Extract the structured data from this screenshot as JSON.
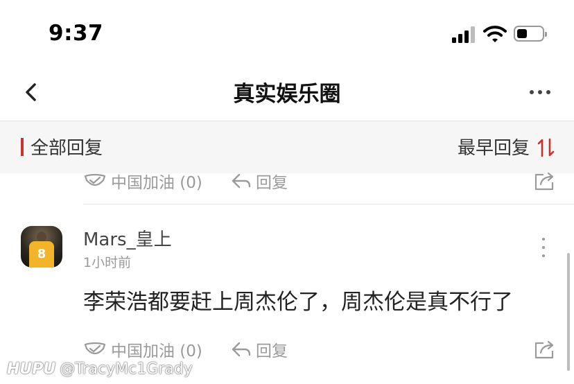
{
  "status_bar": {
    "time": "9:37"
  },
  "nav": {
    "title": "真实娱乐圈"
  },
  "filter": {
    "all_replies": "全部回复",
    "sort": "最早回复",
    "accent": "#c8322e"
  },
  "prev_reply_actions": {
    "cheer": "中国加油 (0)",
    "reply": "回复"
  },
  "comment": {
    "username": "Mars_皇上",
    "time": "1小时前",
    "avatar_number": "8",
    "text": "李荣浩都要赶上周杰伦了，周杰伦是真不行了",
    "actions": {
      "cheer": "中国加油 (0)",
      "reply": "回复"
    }
  },
  "watermark": {
    "brand": "HUPU",
    "handle": "@TracyMc1Grady"
  }
}
